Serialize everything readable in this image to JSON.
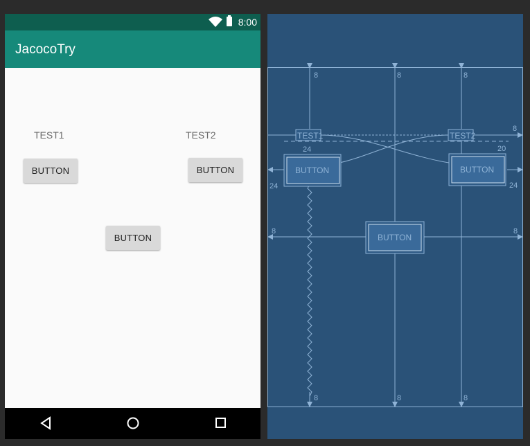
{
  "status_bar": {
    "time": "8:00"
  },
  "app_bar": {
    "title": "JacocoTry"
  },
  "design": {
    "test1_label": "TEST1",
    "test2_label": "TEST2",
    "button_left_label": "BUTTON",
    "button_right_label": "BUTTON",
    "button_center_label": "BUTTON"
  },
  "navigation": {
    "back_icon": "triangle-back-icon",
    "home_icon": "circle-home-icon",
    "recent_icon": "square-recents-icon"
  },
  "blueprint": {
    "test1_label": "TEST1",
    "test2_label": "TEST2",
    "button_left_label": "BUTTON",
    "button_right_label": "BUTTON",
    "button_center_label": "BUTTON",
    "margin_top_left": "8",
    "margin_top_center": "8",
    "margin_top_right": "8",
    "margin_right_test2": "8",
    "margin_gap_left": "24",
    "margin_gap_right": "20",
    "margin_button_left": "24",
    "margin_button_right": "24",
    "margin_center_left": "8",
    "margin_center_right": "8",
    "margin_bottom_left": "8",
    "margin_bottom_center": "8",
    "margin_bottom_right": "8"
  },
  "colors": {
    "status_bar": "#0e5e4f",
    "app_bar": "#16897a",
    "blueprint_bg": "#2a5278",
    "blueprint_line": "#8fb3d6"
  }
}
